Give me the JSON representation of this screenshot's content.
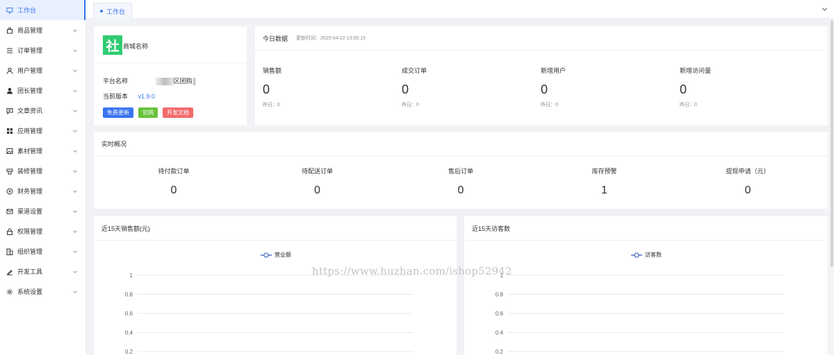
{
  "sidebar": {
    "items": [
      {
        "label": "工作台",
        "icon": "monitor-icon",
        "active": true,
        "has_arrow": false
      },
      {
        "label": "商品管理",
        "icon": "shopping-bag-icon",
        "active": false,
        "has_arrow": true
      },
      {
        "label": "订单管理",
        "icon": "list-icon",
        "active": false,
        "has_arrow": true
      },
      {
        "label": "用户管理",
        "icon": "user-icon",
        "active": false,
        "has_arrow": true
      },
      {
        "label": "团长管理",
        "icon": "person-filled-icon",
        "active": false,
        "has_arrow": true
      },
      {
        "label": "文章资讯",
        "icon": "message-icon",
        "active": false,
        "has_arrow": true
      },
      {
        "label": "应用管理",
        "icon": "apps-grid-icon",
        "active": false,
        "has_arrow": true
      },
      {
        "label": "素材管理",
        "icon": "image-icon",
        "active": false,
        "has_arrow": true
      },
      {
        "label": "装修管理",
        "icon": "decoration-icon",
        "active": false,
        "has_arrow": true
      },
      {
        "label": "财务管理",
        "icon": "yen-circle-icon",
        "active": false,
        "has_arrow": true
      },
      {
        "label": "渠道设置",
        "icon": "mail-icon",
        "active": false,
        "has_arrow": true
      },
      {
        "label": "权限管理",
        "icon": "lock-icon",
        "active": false,
        "has_arrow": true
      },
      {
        "label": "组织管理",
        "icon": "building-icon",
        "active": false,
        "has_arrow": true
      },
      {
        "label": "开发工具",
        "icon": "pen-icon",
        "active": false,
        "has_arrow": true
      },
      {
        "label": "系统设置",
        "icon": "gear-icon",
        "active": false,
        "has_arrow": true
      }
    ]
  },
  "tabs": {
    "active_label": "工作台"
  },
  "info": {
    "logo_char": "社",
    "shop_name": "商城名称",
    "platform_label": "平台名称",
    "platform_value": "区团购",
    "version_label": "当前版本",
    "version_value": "v1.9.0",
    "buttons": {
      "update": "免费更新",
      "website": "官网",
      "docs": "开发文档"
    }
  },
  "today": {
    "title": "今日数据",
    "update_time": "更新时间：2025-04-22 13:50:15",
    "stats": [
      {
        "label": "销售额",
        "value": "0",
        "sub": "昨日：0"
      },
      {
        "label": "成交订单",
        "value": "0",
        "sub": "昨日：0"
      },
      {
        "label": "新增用户",
        "value": "0",
        "sub": "昨日：0"
      },
      {
        "label": "新增访问量",
        "value": "0",
        "sub": "昨日：0"
      }
    ]
  },
  "realtime": {
    "title": "实时概况",
    "items": [
      {
        "label": "待付款订单",
        "value": "0"
      },
      {
        "label": "待配送订单",
        "value": "0"
      },
      {
        "label": "售后订单",
        "value": "0"
      },
      {
        "label": "库存预警",
        "value": "1"
      },
      {
        "label": "提现申请（元）",
        "value": "0"
      }
    ]
  },
  "chart_data": [
    {
      "type": "line",
      "title": "近15天销售额(元)",
      "series": [
        {
          "name": "营业额",
          "values": []
        }
      ],
      "y_ticks": [
        "1",
        "0.8",
        "0.6",
        "0.4",
        "0.2"
      ],
      "ylim": [
        0,
        1
      ],
      "legend": "top-center",
      "color": "#5470c6"
    },
    {
      "type": "line",
      "title": "近15天访客数",
      "series": [
        {
          "name": "访客数",
          "values": []
        }
      ],
      "y_ticks": [
        "1",
        "0.8",
        "0.6",
        "0.4",
        "0.2"
      ],
      "ylim": [
        0,
        1
      ],
      "legend": "top-center",
      "color": "#5470c6"
    }
  ],
  "watermark": "https://www.huzhan.com/ishop52942",
  "colors": {
    "primary": "#3a74f2",
    "success": "#67c23a",
    "danger": "#f26a6a",
    "logo_bg": "#2ecc71"
  }
}
